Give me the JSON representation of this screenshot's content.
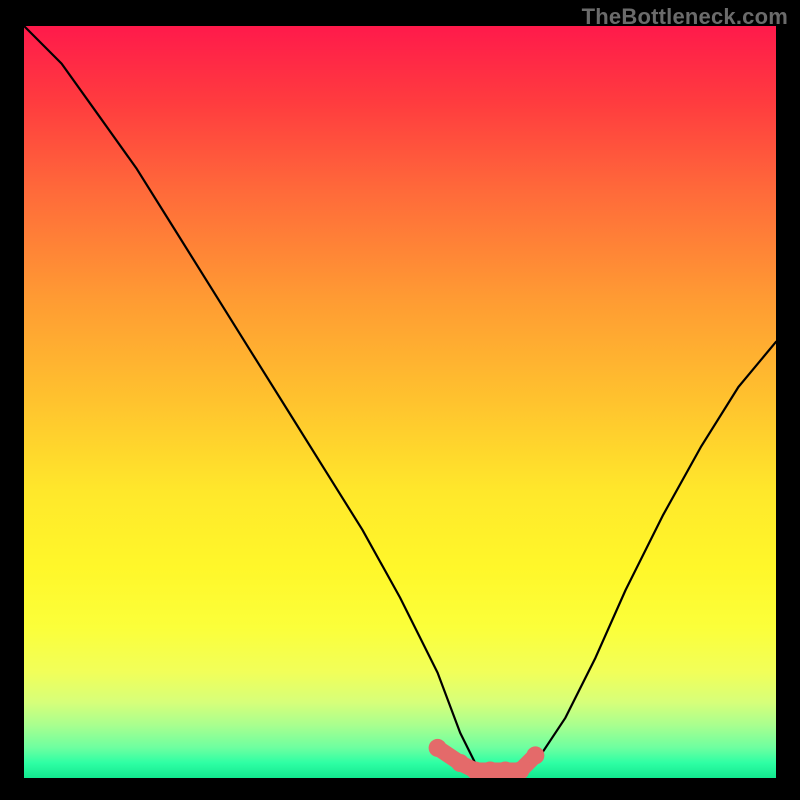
{
  "watermark": "TheBottleneck.com",
  "chart_data": {
    "type": "line",
    "title": "",
    "xlabel": "",
    "ylabel": "",
    "ylim": [
      0,
      100
    ],
    "series": [
      {
        "name": "main-curve",
        "x": [
          0,
          5,
          10,
          15,
          20,
          25,
          30,
          35,
          40,
          45,
          50,
          55,
          58,
          60,
          62,
          64,
          66,
          68,
          72,
          76,
          80,
          85,
          90,
          95,
          100
        ],
        "values": [
          100,
          95,
          88,
          81,
          73,
          65,
          57,
          49,
          41,
          33,
          24,
          14,
          6,
          2,
          1,
          1,
          1,
          2,
          8,
          16,
          25,
          35,
          44,
          52,
          58
        ]
      },
      {
        "name": "highlight-dots",
        "x": [
          55,
          58,
          60,
          62,
          64,
          66,
          68
        ],
        "values": [
          4,
          2,
          1,
          1,
          1,
          1,
          3
        ]
      }
    ],
    "colors": {
      "curve": "#000000",
      "dots": "#e46a6a",
      "gradient_top": "#ff1a4b",
      "gradient_bottom": "#12e88f"
    }
  }
}
